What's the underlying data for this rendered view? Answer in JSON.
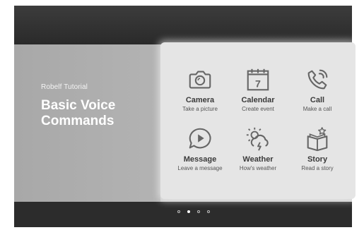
{
  "intro": {
    "subtitle": "Robelf Tutorial",
    "title": "Basic Voice Commands"
  },
  "commands": [
    {
      "label": "Camera",
      "sub": "Take a picture",
      "icon": "camera-icon"
    },
    {
      "label": "Calendar",
      "sub": "Create event",
      "icon": "calendar-icon",
      "day": "7"
    },
    {
      "label": "Call",
      "sub": "Make a call",
      "icon": "phone-icon"
    },
    {
      "label": "Message",
      "sub": "Leave a message",
      "icon": "message-icon"
    },
    {
      "label": "Weather",
      "sub": "How's weather",
      "icon": "weather-icon"
    },
    {
      "label": "Story",
      "sub": "Read a story",
      "icon": "book-icon"
    }
  ],
  "pagination": {
    "count": 4,
    "active_index": 1
  },
  "colors": {
    "icon": "#666666",
    "panel": "#e5e5e5",
    "left_panel": "#aeaeae"
  }
}
